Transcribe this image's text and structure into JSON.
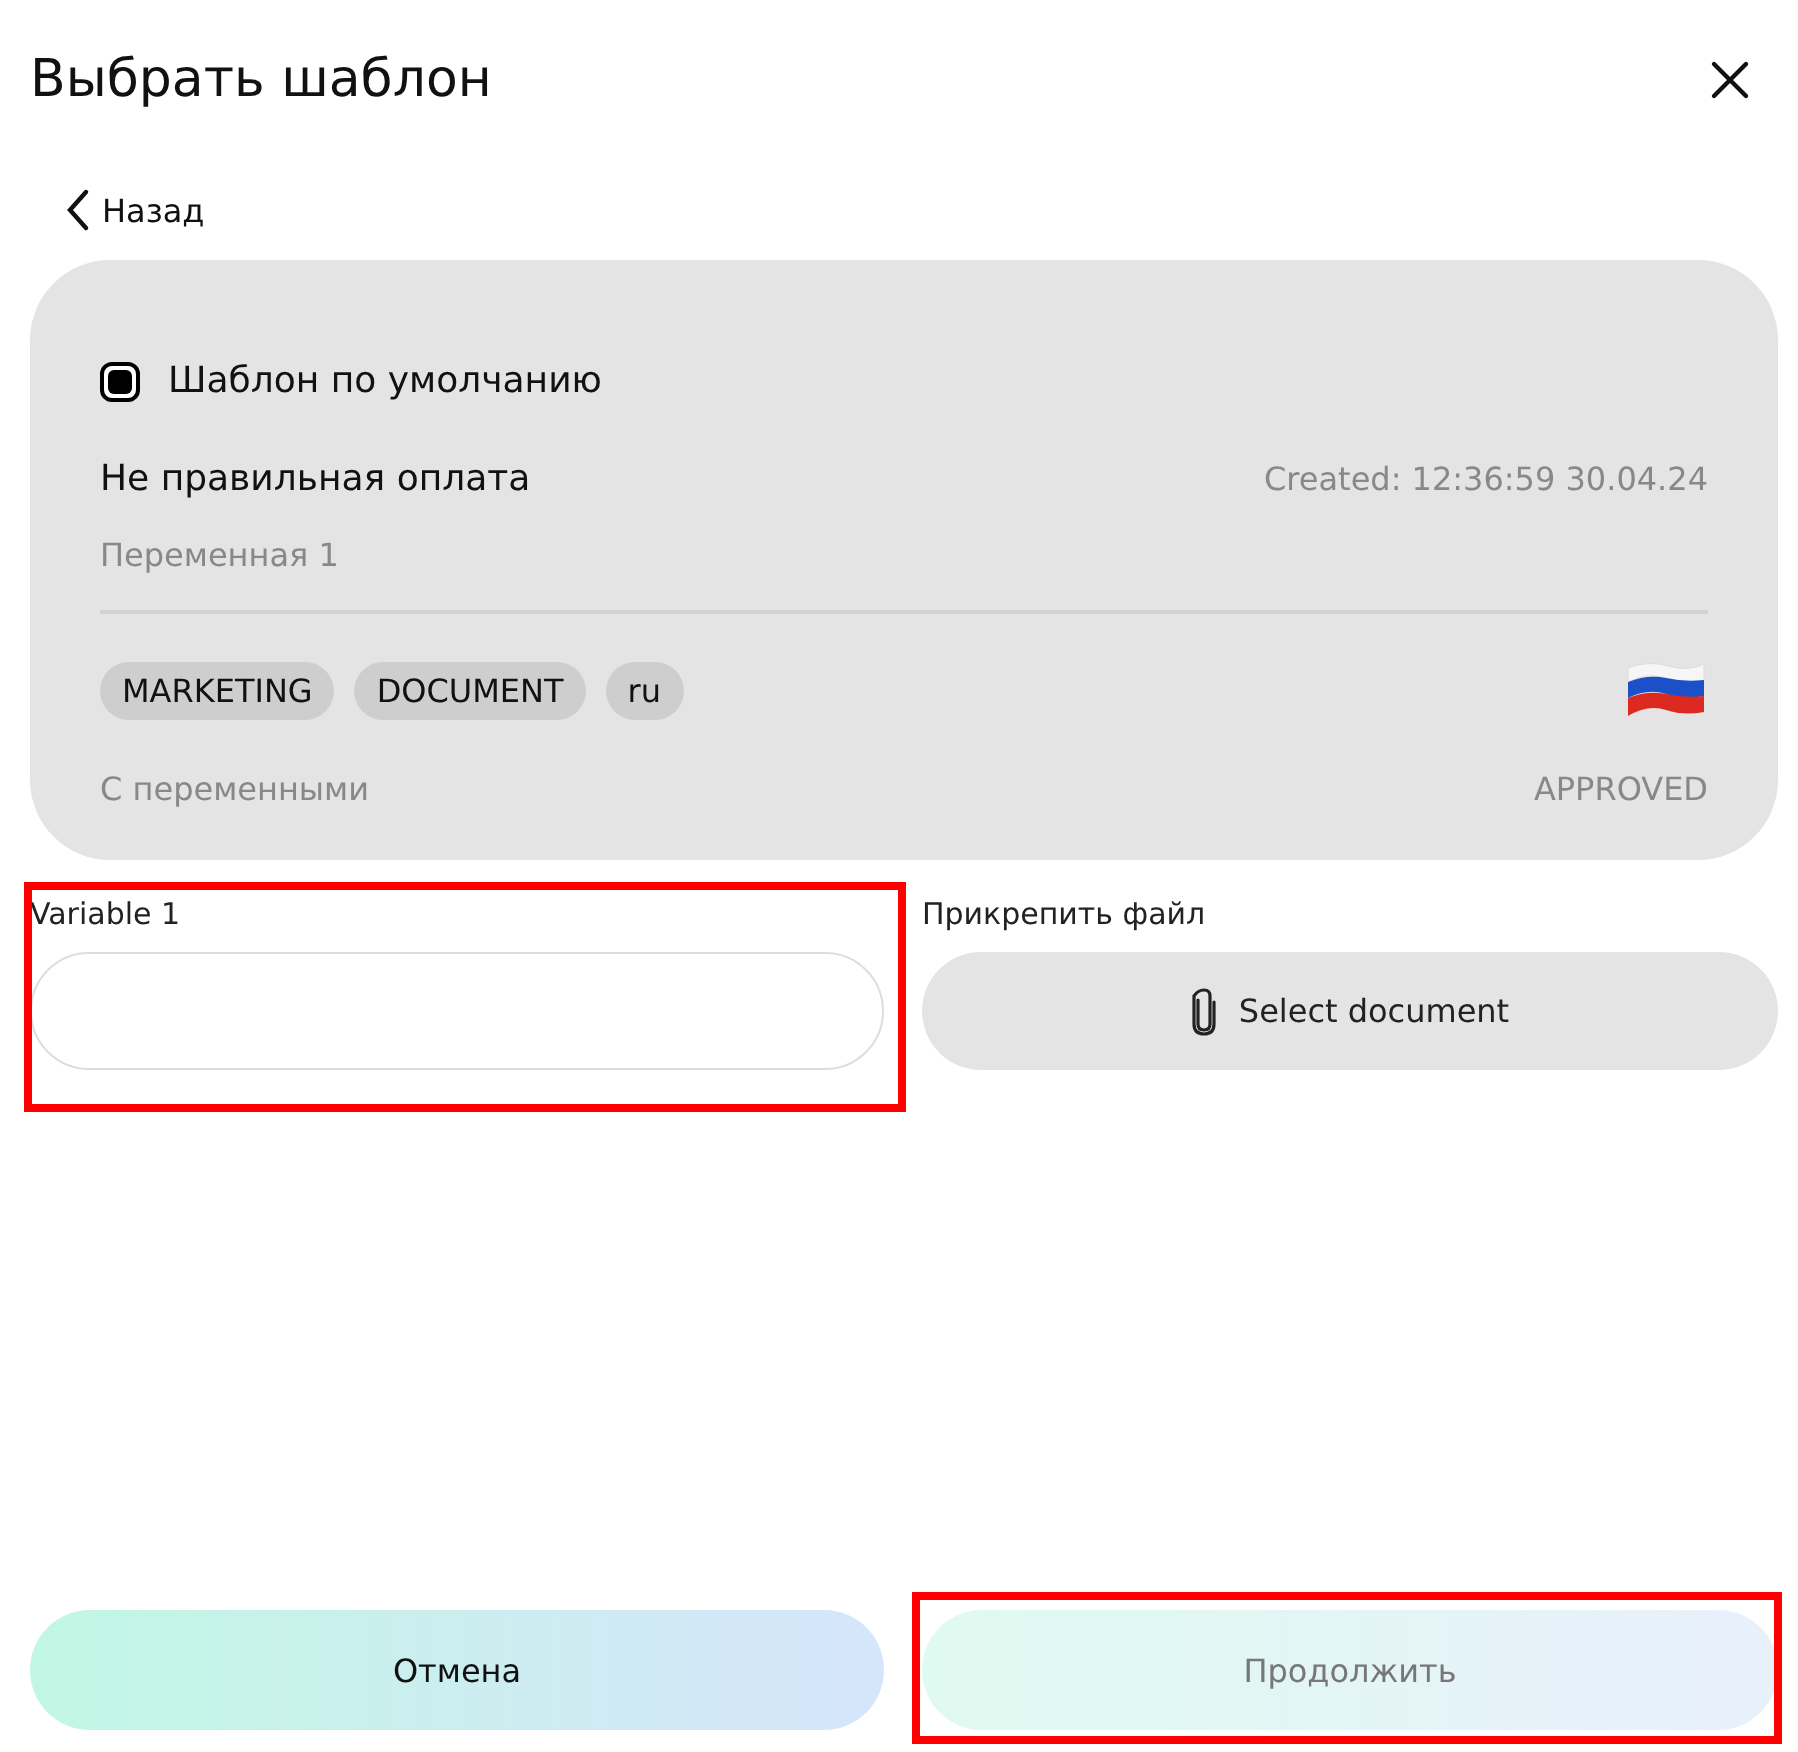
{
  "dialog": {
    "title": "Выбрать шаблон"
  },
  "back_link": {
    "label": "Назад"
  },
  "template": {
    "default_checkbox": {
      "label": "Шаблон по умолчанию",
      "checked": true
    },
    "name": "Не правильная оплата",
    "created": "Created: 12:36:59 30.04.24",
    "variable": "Переменная 1",
    "tags": [
      "MARKETING",
      "DOCUMENT",
      "ru"
    ],
    "type": "С переменными",
    "status": "APPROVED"
  },
  "variables": [
    {
      "label": "Variable 1",
      "highlighted": true
    }
  ],
  "attachment": {
    "label": "Прикрепить файл",
    "button": "Select document"
  },
  "buttons": [
    {
      "label": "Отмена",
      "disabled": false,
      "highlighted": false
    },
    {
      "label": "Продолжить",
      "disabled": true,
      "highlighted": true
    }
  ]
}
